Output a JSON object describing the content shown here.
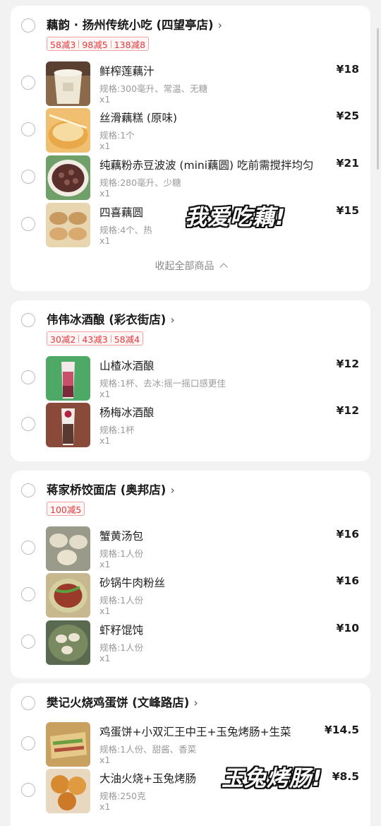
{
  "stores": [
    {
      "name": "藕韵 · 扬州传统小吃 (四望亭店)",
      "promos": [
        "58减3",
        "98减5",
        "138减8"
      ],
      "items": [
        {
          "name": "鲜榨莲藕汁",
          "spec": "规格:300毫升、常温、无糖",
          "qty": "x1",
          "price": "¥18"
        },
        {
          "name": "丝滑藕糕 (原味)",
          "spec": "规格:1个",
          "qty": "x1",
          "price": "¥25"
        },
        {
          "name": "纯藕粉赤豆波波 (mini藕圆) 吃前需搅拌均匀",
          "spec": "规格:280毫升、少糖",
          "qty": "x1",
          "price": "¥21"
        },
        {
          "name": "四喜藕圆",
          "spec": "规格:4个、热",
          "qty": "x1",
          "price": "¥15"
        }
      ],
      "collapse_label": "收起全部商品"
    },
    {
      "name": "伟伟冰酒酿 (彩衣街店)",
      "promos": [
        "30减2",
        "43减3",
        "58减4"
      ],
      "items": [
        {
          "name": "山楂冰酒酿",
          "spec": "规格:1杯、去冰:摇一摇口感更佳",
          "qty": "x1",
          "price": "¥12"
        },
        {
          "name": "杨梅冰酒酿",
          "spec": "规格:1杯",
          "qty": "x1",
          "price": "¥12"
        }
      ]
    },
    {
      "name": "蒋家桥饺面店 (奥邦店)",
      "promos": [
        "100减5"
      ],
      "items": [
        {
          "name": "蟹黄汤包",
          "spec": "规格:1人份",
          "qty": "x1",
          "price": "¥16"
        },
        {
          "name": "砂锅牛肉粉丝",
          "spec": "规格:1人份",
          "qty": "x1",
          "price": "¥16"
        },
        {
          "name": "虾籽馄饨",
          "spec": "规格:1人份",
          "qty": "x1",
          "price": "¥10"
        }
      ]
    },
    {
      "name": "樊记火烧鸡蛋饼 (文峰路店)",
      "promos": [],
      "items": [
        {
          "name": "鸡蛋饼+小双汇王中王+玉兔烤肠+生菜",
          "spec": "规格:1人份、甜酱、香菜",
          "qty": "x1",
          "price": "¥14.5"
        },
        {
          "name": "大油火烧+玉兔烤肠",
          "spec": "规格:250克",
          "qty": "x1",
          "price": "¥8.5"
        }
      ]
    }
  ],
  "overlays": {
    "text1": "我爱吃藕!",
    "text2": "玉兔烤肠!"
  },
  "icons": {
    "chevron_right": "›"
  },
  "colors": {
    "promo_red": "#e4393c",
    "background": "#f2f2f2"
  }
}
